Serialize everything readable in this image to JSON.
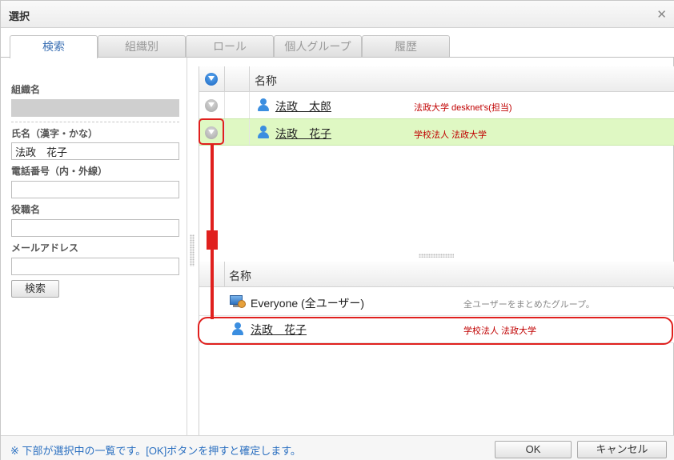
{
  "dialog": {
    "title": "選択"
  },
  "tabs": [
    {
      "label": "検索"
    },
    {
      "label": "組織別"
    },
    {
      "label": "ロール"
    },
    {
      "label": "個人グループ"
    },
    {
      "label": "履歴"
    }
  ],
  "search_form": {
    "org_label": "組織名",
    "name_label": "氏名（漢字・かな）",
    "name_value": "法政　花子",
    "phone_label": "電話番号（内・外線）",
    "phone_value": "",
    "title_label": "役職名",
    "title_value": "",
    "email_label": "メールアドレス",
    "email_value": "",
    "search_button": "検索"
  },
  "results": {
    "header_name": "名称",
    "rows": [
      {
        "name": "法政　太郎",
        "org": "法政大学 desknet's(担当)"
      },
      {
        "name": "法政　花子",
        "org": "学校法人 法政大学"
      }
    ]
  },
  "selected": {
    "header_name": "名称",
    "rows": [
      {
        "name": "Everyone (全ユーザー)",
        "desc": "全ユーザーをまとめたグループ。"
      },
      {
        "name": "法政　花子",
        "org": "学校法人 法政大学"
      }
    ]
  },
  "footer": {
    "note": "※ 下部が選択中の一覧です。[OK]ボタンを押すと確定します。",
    "ok_button": "OK",
    "cancel_button": "キャンセル"
  },
  "colors": {
    "accent_blue": "#3a6fb3",
    "org_red": "#c00000",
    "selected_row": "#dff8c3",
    "annotation_red": "#e0201e"
  }
}
